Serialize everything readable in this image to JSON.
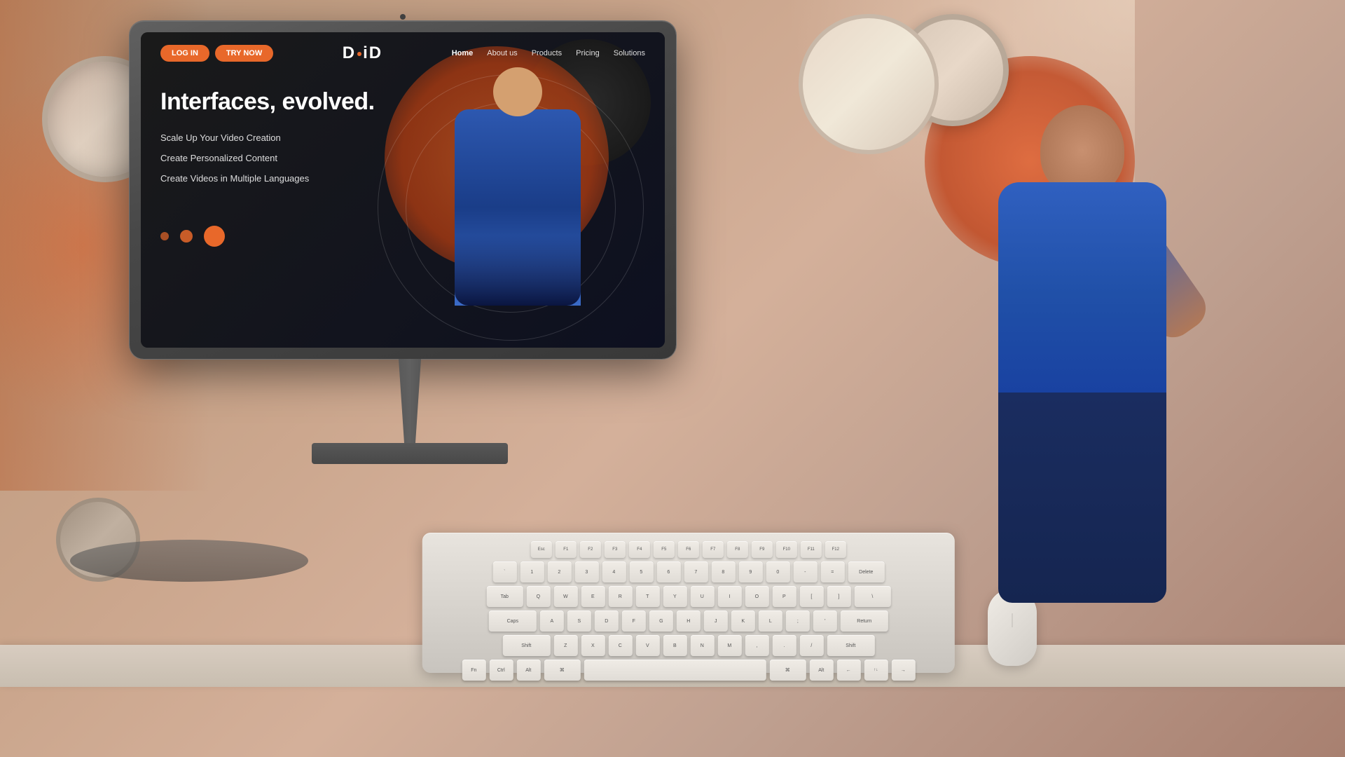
{
  "scene": {
    "title": "D-iD Homepage Screenshot"
  },
  "website": {
    "logo": "D·iD",
    "nav": {
      "buttons": {
        "login": "LOG IN",
        "try": "TRY NOW"
      },
      "links": [
        {
          "label": "Home",
          "active": true
        },
        {
          "label": "About us",
          "active": false
        },
        {
          "label": "Products",
          "active": false
        },
        {
          "label": "Pricing",
          "active": false
        },
        {
          "label": "Solutions",
          "active": false
        }
      ]
    },
    "hero": {
      "title": "Interfaces, evolved.",
      "features": [
        "Scale Up Your Video Creation",
        "Create Personalized Content",
        "Create Videos in Multiple Languages"
      ]
    }
  },
  "keyboard": {
    "rows": [
      [
        "Esc",
        "F1",
        "F2",
        "F3",
        "F4",
        "F5",
        "F6",
        "F7",
        "F8",
        "F9",
        "F10",
        "F11",
        "F12"
      ],
      [
        "`",
        "1",
        "2",
        "3",
        "4",
        "5",
        "6",
        "7",
        "8",
        "9",
        "0",
        "-",
        "=",
        "Delete"
      ],
      [
        "Tab",
        "Q",
        "W",
        "E",
        "R",
        "T",
        "Y",
        "U",
        "I",
        "O",
        "P",
        "[",
        "]",
        "\\"
      ],
      [
        "Caps",
        "A",
        "S",
        "D",
        "F",
        "G",
        "H",
        "J",
        "K",
        "L",
        ";",
        "'",
        "Return"
      ],
      [
        "Shift",
        "Z",
        "X",
        "C",
        "V",
        "B",
        "N",
        "M",
        ",",
        ".",
        "/",
        "Shift"
      ],
      [
        "Fn",
        "Ctrl",
        "Alt",
        "Cmd",
        "",
        "Cmd",
        "Alt",
        "←",
        "↑↓",
        "→"
      ]
    ]
  }
}
